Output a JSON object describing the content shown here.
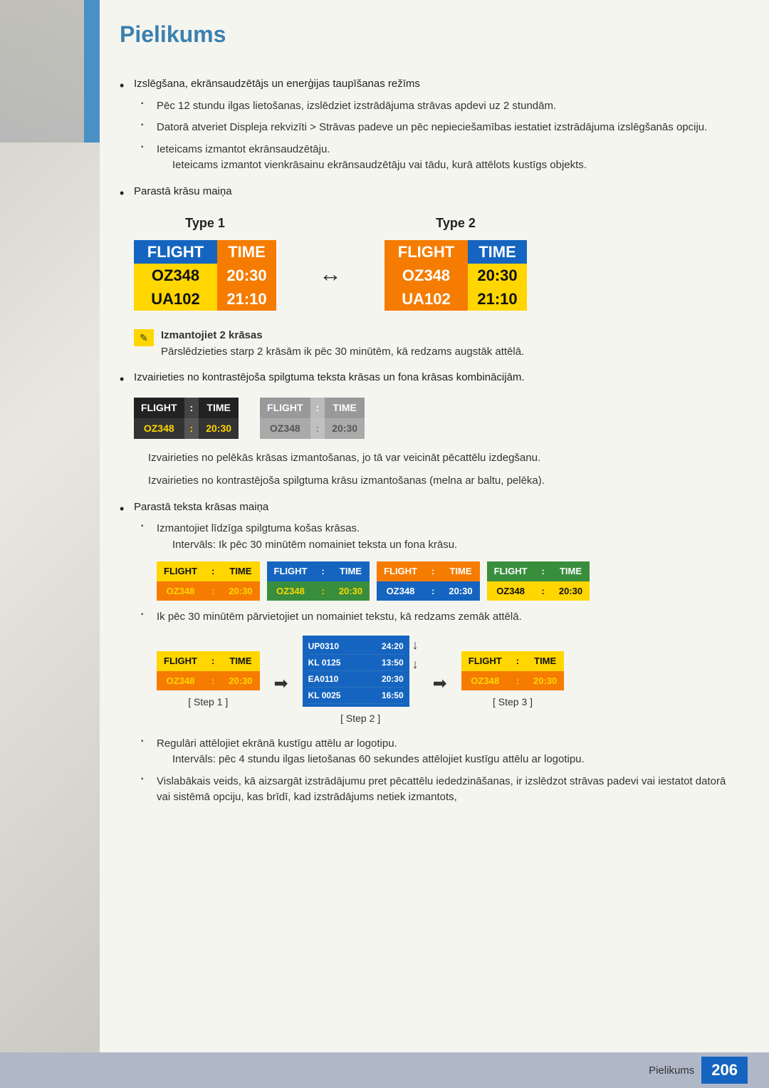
{
  "page": {
    "title": "Pielikums",
    "footer_label": "Pielikums",
    "page_number": "206"
  },
  "content": {
    "bullet1": "Izslēgšana, ekrānsaudzētājs un enerģijas taupīšanas režīms",
    "sub1_1": "Pēc 12 stundu ilgas lietošanas, izslēdziet izstrādājuma strāvas apdevi uz 2 stundām.",
    "sub1_2": "Datorā atveriet Displeja rekvizīti > Strāvas padeve un pēc nepieciešamības iestatiet izstrādājuma izslēgšanās opciju.",
    "sub1_3": "Ieteicams izmantot ekrānsaudzētāju.",
    "sub1_3_note": "Ieteicams izmantot vienkrāsainu ekrānsaudzētāju vai tādu, kurā attēlots kustīgs objekts.",
    "bullet2": "Parastā krāsu maiņa",
    "type1_label": "Type 1",
    "type2_label": "Type 2",
    "flight_label": "FLIGHT",
    "time_label": "TIME",
    "row1_flight": "OZ348",
    "row1_time": "20:30",
    "row2_flight": "UA102",
    "row2_time": "21:10",
    "note1_main": "Izmantojiet 2 krāsas",
    "note1_sub": "Pārslēdzieties starp 2 krāsām ik pēc 30 minūtēm, kā redzams augstāk attēlā.",
    "bullet3": "Izvairieties no kontrastējoša spilgtuma teksta krāsas un fona krāsas kombinācijām.",
    "bullet3_note1": "Izvairieties no pelēkās krāsas izmantošanas, jo tā var veicināt pēcattēlu izdegšanu.",
    "bullet3_note2": "Izvairieties no kontrastējoša spilgtuma krāsu izmantošanas (melna ar baltu, pelēka).",
    "bullet4": "Parastā teksta krāsas maiņa",
    "sub4_1": "Izmantojiet līdzīga spilgtuma košas krāsas.",
    "sub4_1_note": "Intervāls: Ik pēc 30 minūtēm nomainiet teksta un fona krāsu.",
    "sub4_2": "Ik pēc 30 minūtēm pārvietojiet un nomainiet tekstu, kā redzams zemāk attēlā.",
    "step1_label": "[ Step 1 ]",
    "step2_label": "[ Step 2 ]",
    "step3_label": "[ Step 3 ]",
    "step2_data": [
      {
        "flight": "UP0310",
        "time": "24:20"
      },
      {
        "flight": "KL 0125",
        "time": "13:50"
      },
      {
        "flight": "EA0110",
        "time": "20:30"
      },
      {
        "flight": "KL 0025",
        "time": "16:50"
      }
    ],
    "sub4_3": "Regulāri attēlojiet ekrānā kustīgu attēlu ar logotipu.",
    "sub4_3_note": "Intervāls: pēc 4 stundu ilgas lietošanas 60 sekundes attēlojiet kustīgu attēlu ar logotipu.",
    "sub4_4": "Vislabākais veids, kā aizsargāt izstrādājumu pret pēcattēlu iededzināšanas, ir izslēdzot strāvas padevi vai iestatot datorā vai sistēmā opciju, kas brīdī, kad izstrādājums netiek izmantots,"
  }
}
